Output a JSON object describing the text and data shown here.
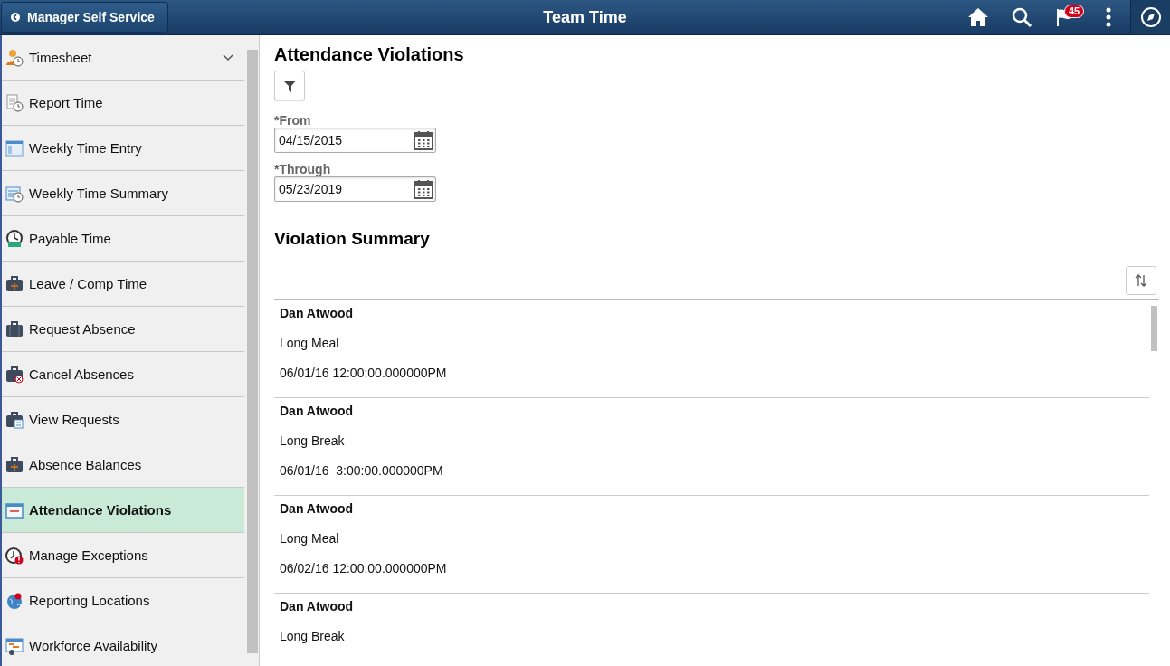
{
  "header": {
    "back_label": "Manager Self Service",
    "title": "Team Time",
    "notification_count": "45"
  },
  "sidebar": {
    "items": [
      {
        "label": "Timesheet",
        "selected": false,
        "expanded": false
      },
      {
        "label": "Report Time",
        "selected": false
      },
      {
        "label": "Weekly Time Entry",
        "selected": false
      },
      {
        "label": "Weekly Time Summary",
        "selected": false
      },
      {
        "label": "Payable Time",
        "selected": false
      },
      {
        "label": "Leave / Comp Time",
        "selected": false
      },
      {
        "label": "Request Absence",
        "selected": false
      },
      {
        "label": "Cancel Absences",
        "selected": false
      },
      {
        "label": "View Requests",
        "selected": false
      },
      {
        "label": "Absence Balances",
        "selected": false
      },
      {
        "label": "Attendance Violations",
        "selected": true
      },
      {
        "label": "Manage Exceptions",
        "selected": false
      },
      {
        "label": "Reporting Locations",
        "selected": false
      },
      {
        "label": "Workforce Availability",
        "selected": false
      }
    ]
  },
  "main": {
    "title": "Attendance Violations",
    "fields": [
      {
        "label": "*From",
        "value": "04/15/2015"
      },
      {
        "label": "*Through",
        "value": "05/23/2019"
      }
    ],
    "summary_title": "Violation Summary",
    "violations": [
      {
        "name": "Dan Atwood",
        "type": "Long Meal",
        "datetime": "06/01/16 12:00:00.000000PM"
      },
      {
        "name": "Dan Atwood",
        "type": "Long Break",
        "datetime": "06/01/16  3:00:00.000000PM"
      },
      {
        "name": "Dan Atwood",
        "type": "Long Meal",
        "datetime": "06/02/16 12:00:00.000000PM"
      },
      {
        "name": "Dan Atwood",
        "type": "Long Break"
      }
    ]
  }
}
